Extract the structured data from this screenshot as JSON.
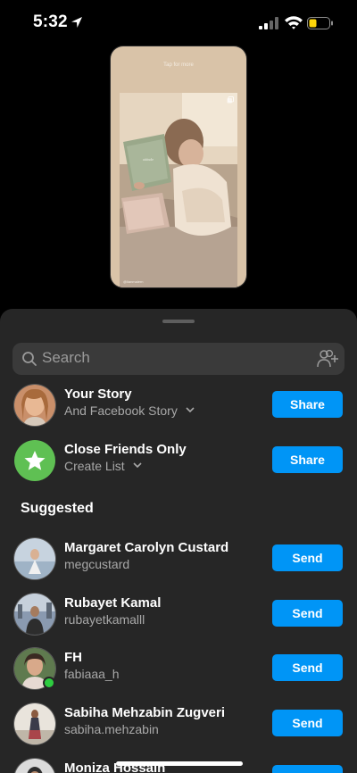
{
  "status_bar": {
    "time": "5:32"
  },
  "story_preview": {
    "tap_hint": "Tap for more",
    "credit_handle": "@lianmalern"
  },
  "search": {
    "placeholder": "Search"
  },
  "share_targets": [
    {
      "title": "Your Story",
      "subtitle": "And Facebook Story",
      "button": "Share"
    },
    {
      "title": "Close Friends Only",
      "subtitle": "Create List",
      "button": "Share"
    }
  ],
  "suggested_heading": "Suggested",
  "suggested": [
    {
      "name": "Margaret Carolyn Custard",
      "username": "megcustard",
      "button": "Send"
    },
    {
      "name": "Rubayet Kamal",
      "username": "rubayetkamalll",
      "button": "Send"
    },
    {
      "name": "FH",
      "username": "fabiaaa_h",
      "button": "Send",
      "online": true
    },
    {
      "name": "Sabiha Mehzabin Zugveri",
      "username": "sabiha.mehzabin",
      "button": "Send"
    },
    {
      "name": "Moniza Hossain",
      "username": "",
      "button": "Send"
    }
  ],
  "colors": {
    "accent": "#0095f6",
    "sheet": "#262626",
    "close_friends": "#5fc053",
    "online": "#2ecc40"
  }
}
